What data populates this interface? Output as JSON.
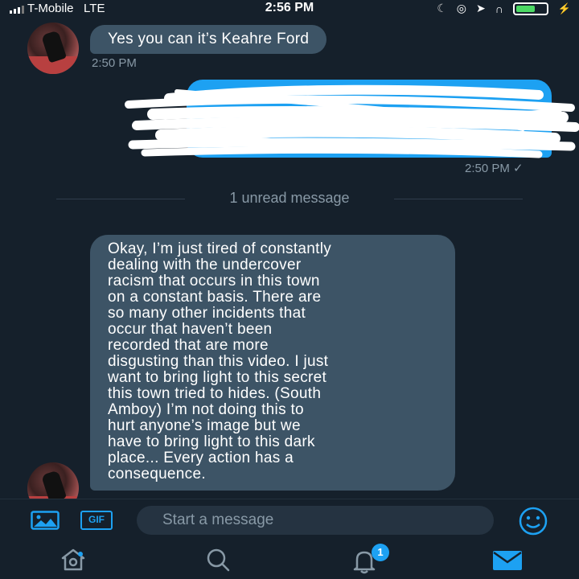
{
  "status_bar": {
    "carrier": "T-Mobile",
    "network": "LTE",
    "time": "2:56 PM",
    "battery_level": 0.65
  },
  "messages": {
    "first": {
      "text": "Yes you can it’s Keahre Ford",
      "timestamp": "2:50 PM"
    },
    "outgoing": {
      "text": "",
      "timestamp": "2:50 PM ✓"
    },
    "unread_divider": "1 unread message",
    "second": {
      "text": "Okay, I’m just tired of constantly\ndealing with the undercover\nracism that occurs in this town\non a constant basis. There are\nso many other incidents that\noccur that haven’t been\nrecorded that are more\ndisgusting than this video. I just\nwant to bring light to this secret\nthis town tried to hides. (South\nAmboy) I’m not doing this to\nhurt anyone’s image but we\nhave to bring light to this dark\nplace... Every action has a\nconsequence."
    }
  },
  "composer": {
    "placeholder": "Start a message",
    "gif_label": "GIF"
  },
  "tabbar": {
    "notifications_badge": "1"
  },
  "colors": {
    "background": "#15202b",
    "incoming_bubble": "#3d5466",
    "outgoing_bubble": "#1da1f2",
    "accent": "#1da1f2",
    "muted_text": "#8899a6"
  },
  "icons": [
    "image-icon",
    "gif-icon",
    "emoji-icon",
    "home-icon",
    "search-icon",
    "bell-icon",
    "mail-icon"
  ]
}
